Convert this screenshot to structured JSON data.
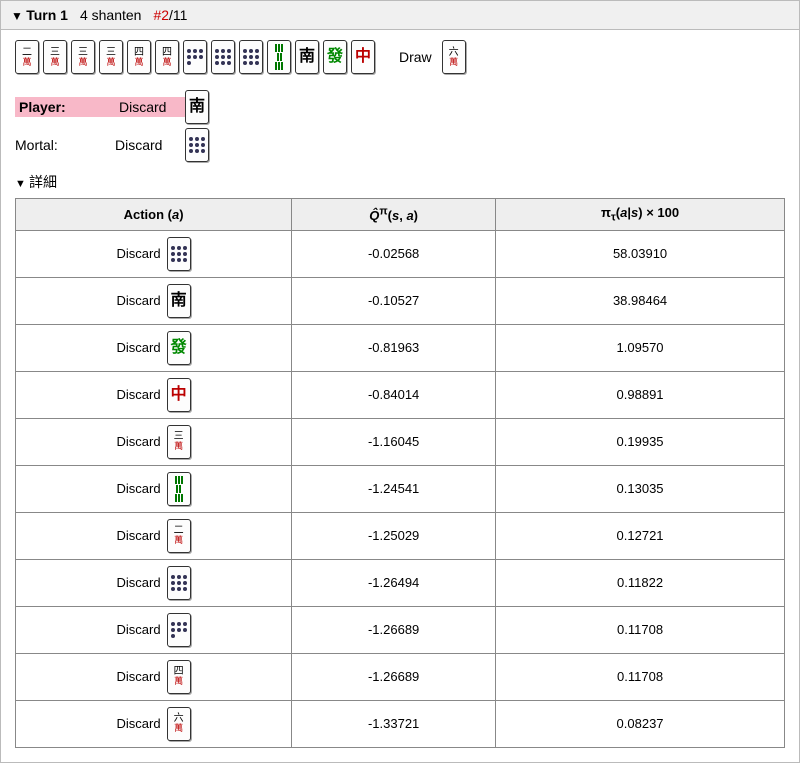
{
  "header": {
    "turn_label": "Turn 1",
    "shanten": "4 shanten",
    "rank": "#2",
    "rank_total": "/11"
  },
  "hand": {
    "tiles": [
      "2m",
      "3m",
      "3m",
      "3m",
      "4m",
      "4m",
      "7p",
      "9p",
      "9p",
      "8s",
      "nan",
      "hatsu",
      "chun"
    ],
    "draw_label": "Draw",
    "draw_tile": "6m"
  },
  "decisions": {
    "player_label": "Player:",
    "player_action": "Discard",
    "player_tile": "nan",
    "mortal_label": "Mortal:",
    "mortal_action": "Discard",
    "mortal_tile": "9p"
  },
  "details": {
    "toggle": "詳細",
    "col_action": "Action (a)",
    "col_q": "Q̂π(s, a)",
    "col_pi": "πτ(a|s) × 100",
    "discard_word": "Discard",
    "rows": [
      {
        "tile": "9p",
        "q": "-0.02568",
        "pi": "58.03910"
      },
      {
        "tile": "nan",
        "q": "-0.10527",
        "pi": "38.98464"
      },
      {
        "tile": "hatsu",
        "q": "-0.81963",
        "pi": "1.09570"
      },
      {
        "tile": "chun",
        "q": "-0.84014",
        "pi": "0.98891"
      },
      {
        "tile": "3m",
        "q": "-1.16045",
        "pi": "0.19935"
      },
      {
        "tile": "8s",
        "q": "-1.24541",
        "pi": "0.13035"
      },
      {
        "tile": "2m",
        "q": "-1.25029",
        "pi": "0.12721"
      },
      {
        "tile": "9p_b",
        "q": "-1.26494",
        "pi": "0.11822"
      },
      {
        "tile": "7p",
        "q": "-1.26689",
        "pi": "0.11708"
      },
      {
        "tile": "4m",
        "q": "-1.26689",
        "pi": "0.11708"
      },
      {
        "tile": "6m",
        "q": "-1.33721",
        "pi": "0.08237"
      }
    ]
  },
  "tile_defs": {
    "2m": {
      "kind": "man",
      "num": "二"
    },
    "3m": {
      "kind": "man",
      "num": "三"
    },
    "4m": {
      "kind": "man",
      "num": "四"
    },
    "6m": {
      "kind": "man",
      "num": "六"
    },
    "7p": {
      "kind": "pin",
      "dots": 7
    },
    "9p": {
      "kind": "pin",
      "dots": 9
    },
    "9p_b": {
      "kind": "pin",
      "dots": 9
    },
    "8s": {
      "kind": "suo",
      "sticks": 8
    },
    "nan": {
      "kind": "honor",
      "char": "南",
      "cls": ""
    },
    "hatsu": {
      "kind": "honor",
      "char": "發",
      "cls": "green"
    },
    "chun": {
      "kind": "honor",
      "char": "中",
      "cls": "red"
    }
  }
}
